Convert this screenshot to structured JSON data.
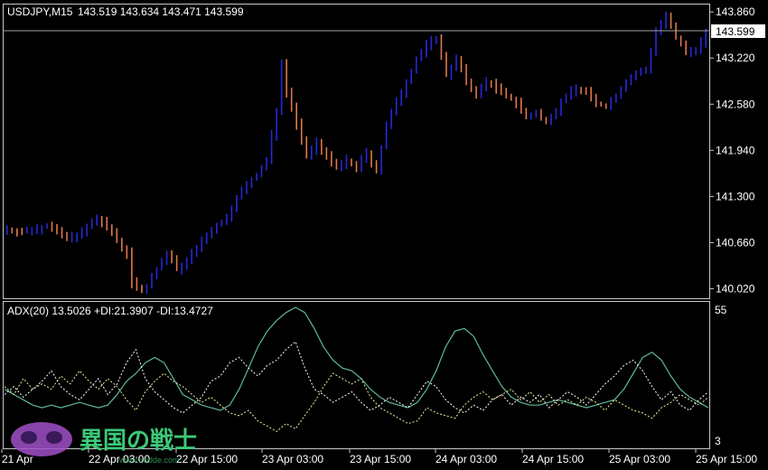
{
  "header": {
    "symbol_timeframe": "USDJPY,M15",
    "ohlc": "143.519 143.634 143.471 143.599"
  },
  "indicator": {
    "label": "ADX(20) 13.5026 +DI:21.3907 -DI:13.4727"
  },
  "current_price_label": "143.599",
  "watermark": {
    "text": "異国の戦士",
    "subtext": "www.tradde.com"
  },
  "colors": {
    "background": "#000000",
    "frame": "#c8c8c8",
    "candle_up": "#2828dc",
    "candle_down": "#e07848",
    "adx": "#5fb89a",
    "plus_di": "#ffffff",
    "minus_di": "#f0f0a0",
    "price_line": "#a0a0a0",
    "watermark_text": "#3cc878",
    "watermark_logo": "#a050c8"
  },
  "chart_data": [
    {
      "type": "candlestick",
      "symbol": "USDJPY",
      "timeframe": "M15",
      "ylim": [
        139.9,
        143.95
      ],
      "y_ticks": [
        143.86,
        143.22,
        142.58,
        141.94,
        141.3,
        140.66,
        140.02
      ],
      "y_tick_labels": [
        "143.860",
        "143.220",
        "142.580",
        "141.940",
        "141.300",
        "140.660",
        "140.020"
      ],
      "x_tick_labels": [
        "21 Apr",
        "22 Apr 03:00",
        "22 Apr 15:00",
        "23 Apr 03:00",
        "23 Apr 15:00",
        "24 Apr 03:00",
        "24 Apr 15:00",
        "25 Apr 03:00",
        "25 Apr 15:00"
      ],
      "current_price": 143.599,
      "close_path": [
        [
          0,
          140.85
        ],
        [
          3,
          140.8
        ],
        [
          8,
          140.9
        ],
        [
          12,
          140.72
        ],
        [
          15,
          140.8
        ],
        [
          18,
          141.0
        ],
        [
          21,
          140.8
        ],
        [
          24,
          140.5
        ],
        [
          25,
          140.1
        ],
        [
          27,
          140.0
        ],
        [
          28,
          140.05
        ],
        [
          30,
          140.3
        ],
        [
          32,
          140.5
        ],
        [
          34,
          140.3
        ],
        [
          36,
          140.4
        ],
        [
          38,
          140.6
        ],
        [
          40,
          140.75
        ],
        [
          42,
          140.9
        ],
        [
          44,
          141.0
        ],
        [
          46,
          141.3
        ],
        [
          48,
          141.45
        ],
        [
          50,
          141.6
        ],
        [
          52,
          141.8
        ],
        [
          54,
          142.5
        ],
        [
          55,
          143.15
        ],
        [
          56,
          142.75
        ],
        [
          58,
          142.3
        ],
        [
          60,
          141.85
        ],
        [
          62,
          142.05
        ],
        [
          64,
          141.85
        ],
        [
          66,
          141.7
        ],
        [
          68,
          141.8
        ],
        [
          70,
          141.7
        ],
        [
          72,
          141.9
        ],
        [
          74,
          141.65
        ],
        [
          76,
          142.3
        ],
        [
          78,
          142.6
        ],
        [
          80,
          142.9
        ],
        [
          82,
          143.2
        ],
        [
          84,
          143.4
        ],
        [
          86,
          143.5
        ],
        [
          88,
          143.0
        ],
        [
          90,
          143.2
        ],
        [
          92,
          142.9
        ],
        [
          94,
          142.7
        ],
        [
          96,
          142.9
        ],
        [
          98,
          142.8
        ],
        [
          100,
          142.7
        ],
        [
          102,
          142.6
        ],
        [
          104,
          142.4
        ],
        [
          106,
          142.45
        ],
        [
          108,
          142.35
        ],
        [
          110,
          142.5
        ],
        [
          112,
          142.7
        ],
        [
          114,
          142.8
        ],
        [
          116,
          142.75
        ],
        [
          118,
          142.6
        ],
        [
          120,
          142.55
        ],
        [
          122,
          142.7
        ],
        [
          124,
          142.9
        ],
        [
          126,
          143.0
        ],
        [
          128,
          143.05
        ],
        [
          130,
          143.6
        ],
        [
          132,
          143.8
        ],
        [
          134,
          143.5
        ],
        [
          136,
          143.3
        ],
        [
          138,
          143.35
        ],
        [
          140,
          143.55
        ]
      ]
    },
    {
      "type": "line",
      "title": "ADX(20)",
      "ylim": [
        3,
        55
      ],
      "y_tick_labels": [
        "55",
        "3"
      ],
      "series": [
        {
          "name": "ADX",
          "values": [
            24,
            22,
            20,
            18,
            17,
            18,
            17,
            18,
            19,
            18,
            17,
            18,
            22,
            27,
            30,
            34,
            36,
            34,
            28,
            22,
            20,
            18,
            17,
            16,
            18,
            24,
            32,
            40,
            46,
            50,
            53,
            55,
            53,
            47,
            40,
            35,
            32,
            31,
            28,
            24,
            21,
            19,
            18,
            17,
            19,
            24,
            31,
            40,
            46,
            47,
            44,
            37,
            31,
            25,
            21,
            19,
            18,
            18,
            19,
            20,
            19,
            18,
            17,
            18,
            19,
            20,
            24,
            30,
            36,
            38,
            35,
            29,
            24,
            21,
            19,
            17
          ]
        },
        {
          "name": "+DI",
          "values": [
            22,
            25,
            21,
            24,
            27,
            31,
            25,
            22,
            20,
            24,
            28,
            22,
            26,
            34,
            39,
            28,
            23,
            20,
            17,
            15,
            18,
            21,
            27,
            29,
            34,
            36,
            32,
            29,
            33,
            35,
            39,
            42,
            32,
            24,
            22,
            19,
            21,
            23,
            19,
            16,
            18,
            21,
            19,
            17,
            22,
            27,
            25,
            20,
            17,
            15,
            18,
            16,
            20,
            22,
            18,
            21,
            19,
            22,
            17,
            20,
            23,
            21,
            18,
            22,
            26,
            29,
            33,
            35,
            31,
            25,
            20,
            23,
            18,
            16,
            20,
            23
          ]
        },
        {
          "name": "-DI",
          "values": [
            25,
            22,
            28,
            24,
            26,
            24,
            29,
            26,
            31,
            27,
            24,
            28,
            25,
            20,
            16,
            23,
            27,
            30,
            27,
            25,
            22,
            19,
            21,
            18,
            15,
            14,
            16,
            12,
            10,
            8,
            11,
            9,
            14,
            19,
            25,
            30,
            28,
            26,
            28,
            21,
            17,
            15,
            13,
            11,
            12,
            17,
            15,
            14,
            13,
            18,
            21,
            23,
            20,
            22,
            24,
            20,
            23,
            19,
            22,
            18,
            20,
            18,
            21,
            19,
            16,
            20,
            18,
            16,
            15,
            13,
            17,
            19,
            22,
            20,
            18,
            21
          ]
        }
      ]
    }
  ]
}
